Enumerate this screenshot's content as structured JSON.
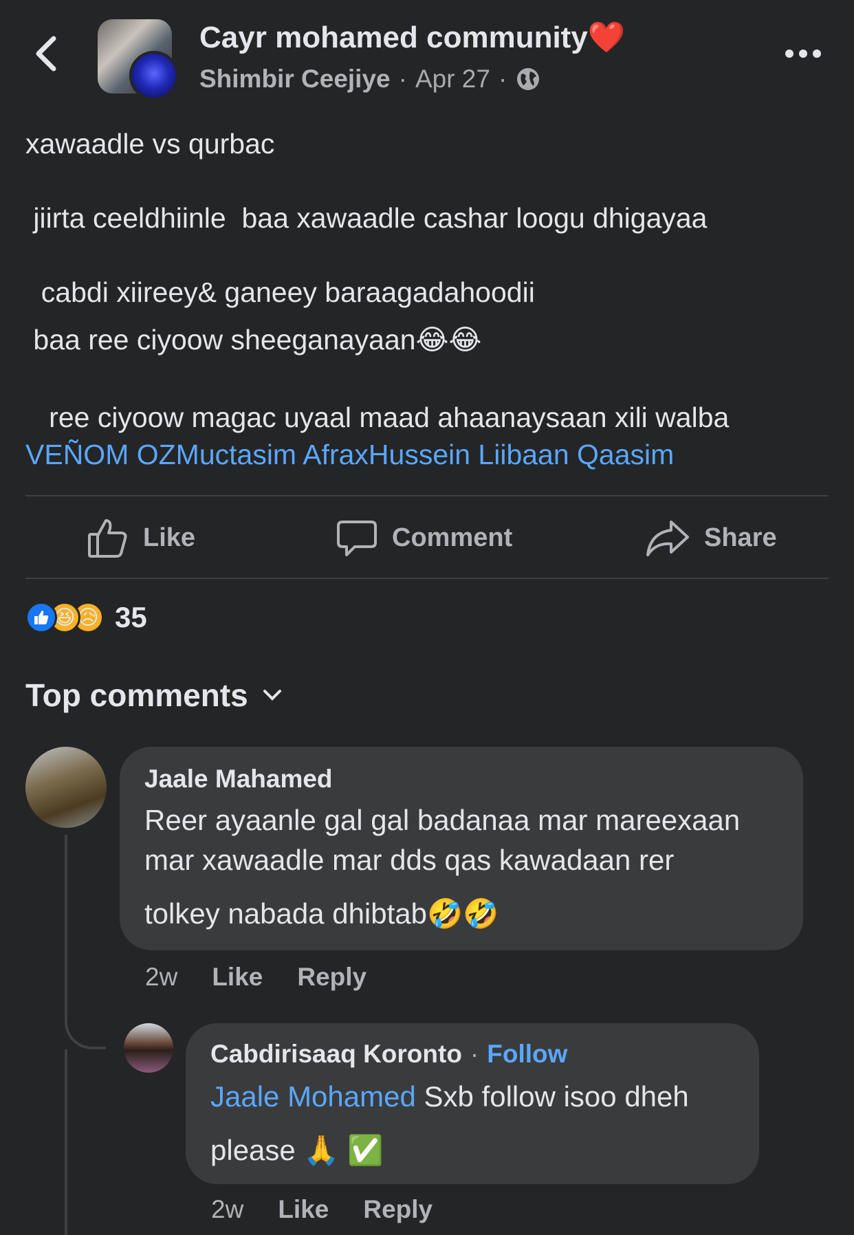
{
  "header": {
    "group_name": "Cayr mohamed community❤️",
    "author": "Shimbir Ceejiye",
    "sep1": "·",
    "date": "Apr 27",
    "sep2": "·"
  },
  "post": {
    "line1": "xawaadle vs qurbac",
    "line2": " jiirta ceeldhiinle  baa xawaadle cashar loogu dhigayaa",
    "line3": "  cabdi xiireey& ganeey baraagadahoodii",
    "line4": " baa ree ciyoow sheeganayaan😂😂",
    "line5": "   ree ciyoow magac uyaal maad ahaanaysaan xili walba",
    "mentions": "VEÑOM OZMuctasim AfraxHussein Liibaan Qaasim"
  },
  "actions": {
    "like": "Like",
    "comment": "Comment",
    "share": "Share"
  },
  "reactions": {
    "count": "35"
  },
  "comments_header": "Top comments",
  "comments": [
    {
      "name": "Jaale Mahamed",
      "text_1": "Reer ayaanle gal gal badanaa mar mareexaan",
      "text_2": "mar xawaadle mar dds qas kawadaan rer",
      "text_3": "tolkey nabada dhibtab🤣🤣",
      "time": "2w",
      "like": "Like",
      "reply": "Reply"
    },
    {
      "name": "Cabdirisaaq Koronto",
      "dot": "·",
      "follow": "Follow",
      "mention": "Jaale Mohamed",
      "text_1": " Sxb follow isoo dheh",
      "text_2": "please 🙏 ✅",
      "time": "2w",
      "like": "Like",
      "reply": "Reply"
    }
  ],
  "colors": {
    "background": "#242526",
    "bubble": "#3a3b3c",
    "link": "#5aa7ff",
    "like_blue": "#1877f2"
  }
}
